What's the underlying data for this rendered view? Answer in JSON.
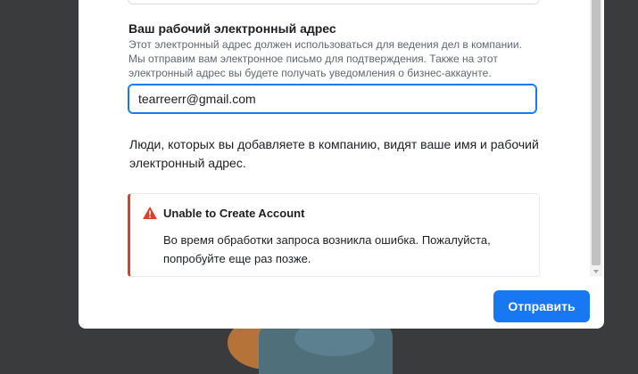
{
  "form": {
    "work_email_label": "Ваш рабочий электронный адрес",
    "work_email_help": "Этот электронный адрес должен использоваться для ведения дел в компании. Мы отправим вам электронное письмо для подтверждения. Также на этот электронный адрес вы будете получать уведомления о бизнес-аккаунте.",
    "work_email_value": "tearreerr@gmail.com",
    "visibility_note": "Люди, которых вы добавляете в компанию, видят ваше имя и рабочий электронный адрес."
  },
  "error": {
    "icon": "warning-triangle-icon",
    "title": "Unable to Create Account",
    "message": "Во время обработки запроса возникла ошибка. Пожалуйста, попробуйте еще раз позже.",
    "accent_color": "#d9412c"
  },
  "footer": {
    "submit_label": "Отправить"
  },
  "colors": {
    "primary": "#1877f2",
    "backdrop": "#3a3b3c"
  }
}
